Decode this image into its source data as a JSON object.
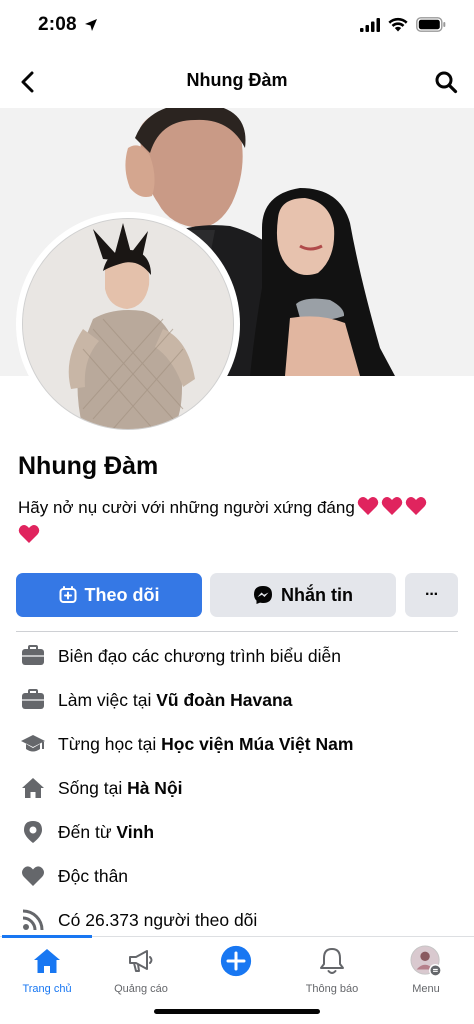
{
  "status_bar": {
    "time": "2:08"
  },
  "nav": {
    "title": "Nhung Đàm"
  },
  "profile": {
    "name": "Nhung Đàm",
    "bio": "Hãy nở nụ cười với những người xứng đáng"
  },
  "actions": {
    "follow_label": "Theo dõi",
    "message_label": "Nhắn tin",
    "more_label": "···"
  },
  "intro": {
    "item0": {
      "text": "Biên đạo các chương trình biểu diễn",
      "icon": "briefcase-icon"
    },
    "item1": {
      "prefix": "Làm việc tại ",
      "bold": "Vũ đoàn Havana",
      "icon": "briefcase-icon"
    },
    "item2": {
      "prefix": "Từng học tại ",
      "bold": "Học viện Múa Việt Nam",
      "icon": "graduation-cap-icon"
    },
    "item3": {
      "prefix": "Sống tại ",
      "bold": "Hà Nội",
      "icon": "home-icon"
    },
    "item4": {
      "prefix": "Đến từ ",
      "bold": "Vinh",
      "icon": "location-pin-icon"
    },
    "item5": {
      "text": "Độc thân",
      "icon": "heart-icon"
    },
    "item6": {
      "text": "Có 26.373 người theo dõi",
      "icon": "rss-icon"
    }
  },
  "tabs": {
    "home": "Trang chủ",
    "ads": "Quảng cáo",
    "notifications": "Thông báo",
    "menu": "Menu"
  },
  "colors": {
    "accent": "#1877f2",
    "follow_button": "#3578e5",
    "secondary_button": "#e4e6eb",
    "heart": "#e0245e"
  }
}
